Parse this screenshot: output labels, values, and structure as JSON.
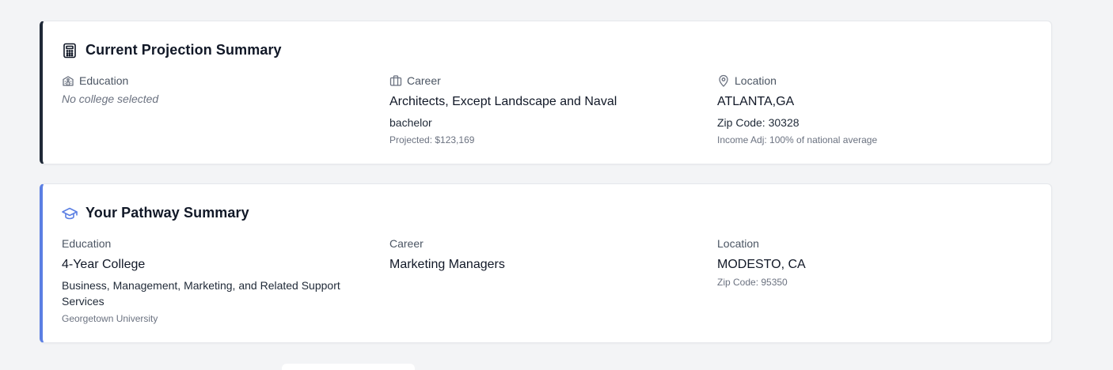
{
  "projection": {
    "title": "Current Projection Summary",
    "title_icon": "calculator-icon",
    "education": {
      "label": "Education",
      "icon": "school-icon",
      "value": "No college selected"
    },
    "career": {
      "label": "Career",
      "icon": "briefcase-icon",
      "value": "Architects, Except Landscape and Naval",
      "degree": "bachelor",
      "projected": "Projected: $123,169"
    },
    "location": {
      "label": "Location",
      "icon": "map-pin-icon",
      "value": "ATLANTA,GA",
      "zip": "Zip Code: 30328",
      "income_adj": "Income Adj: 100% of national average"
    },
    "accent_color": "#1f2937"
  },
  "pathway": {
    "title": "Your Pathway Summary",
    "title_icon": "graduation-cap-icon",
    "education": {
      "label": "Education",
      "value": "4-Year College",
      "major": "Business, Management, Marketing, and Related Support Services",
      "school": "Georgetown University"
    },
    "career": {
      "label": "Career",
      "value": "Marketing Managers"
    },
    "location": {
      "label": "Location",
      "value": "MODESTO, CA",
      "zip": "Zip Code: 95350"
    },
    "accent_color": "#5b7fe3"
  }
}
